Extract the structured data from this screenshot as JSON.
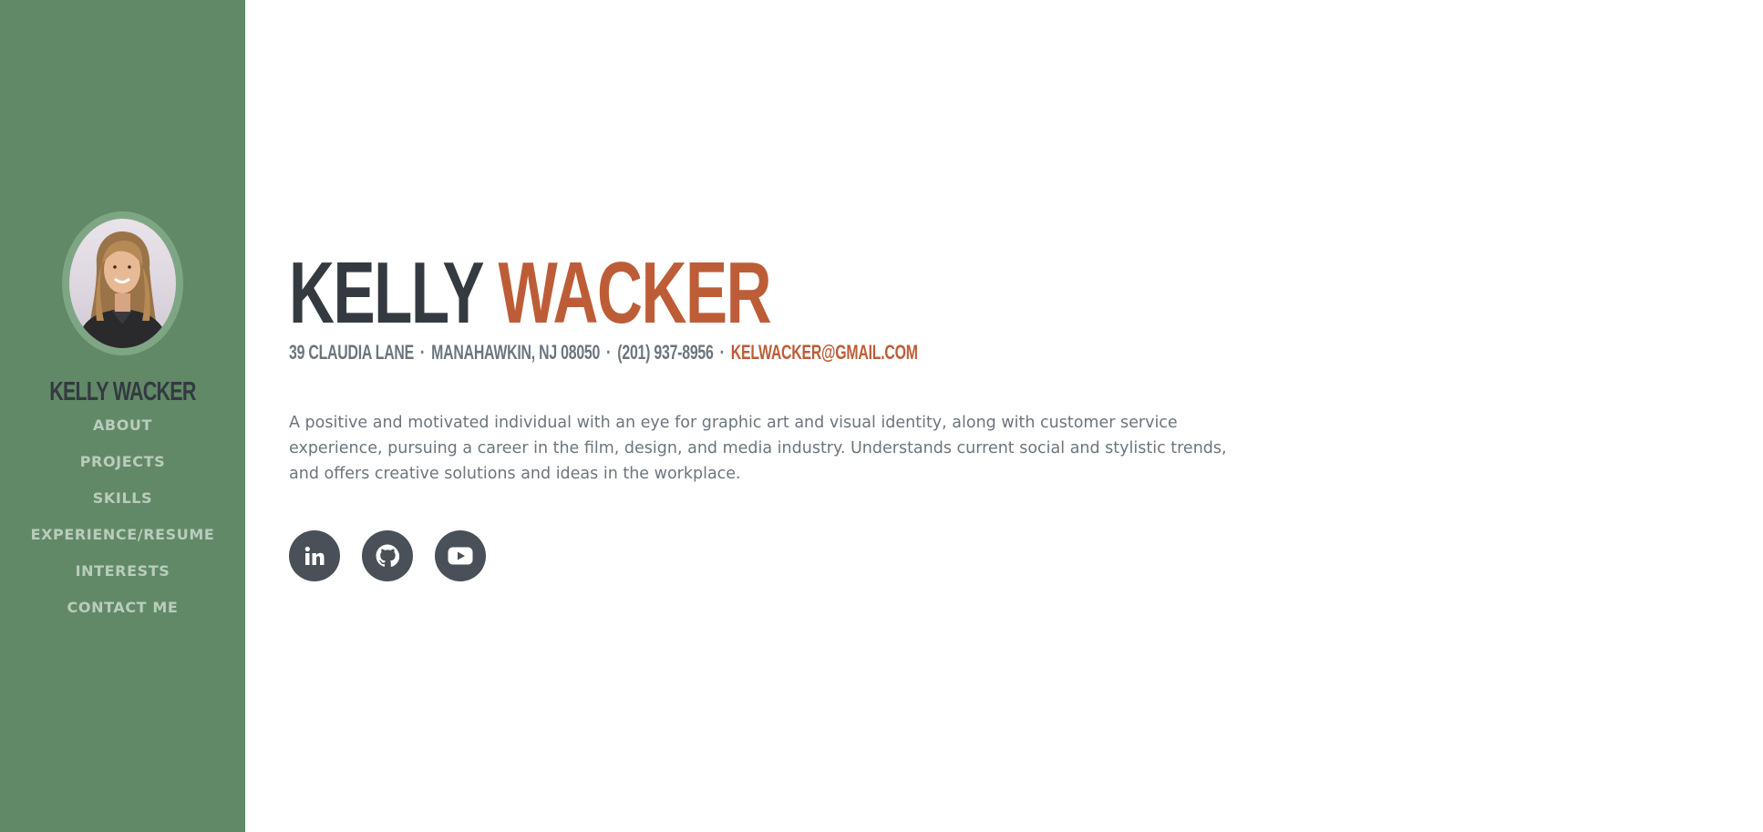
{
  "sidebar": {
    "brand": "Kelly Wacker",
    "avatar_alt": "Profile photo",
    "nav": [
      {
        "label": "ABOUT"
      },
      {
        "label": "PROJECTS"
      },
      {
        "label": "SKILLS"
      },
      {
        "label": "EXPERIENCE/RESUME"
      },
      {
        "label": "INTERESTS"
      },
      {
        "label": "CONTACT ME"
      }
    ]
  },
  "main": {
    "first_name": "Kelly",
    "last_name": "Wacker",
    "address": "39 Claudia Lane",
    "city": "Manahawkin, NJ 08050",
    "phone": "(201) 937-8956",
    "email": "kelwacker@gmail.com",
    "separator": "·",
    "bio": "A positive and motivated individual with an eye for graphic art and visual identity, along with customer service experience, pursuing a career in the film, design, and media industry. Understands current social and stylistic trends, and offers creative solutions and ideas in the workplace."
  },
  "socials": [
    {
      "icon": "linkedin-icon"
    },
    {
      "icon": "github-icon"
    },
    {
      "icon": "youtube-icon"
    }
  ],
  "colors": {
    "sidebar_bg": "#618967",
    "accent": "#bd5d38",
    "dark": "#343a40",
    "muted": "#6c757d",
    "nav_text": "#b9cdbb",
    "social_bg": "#495057"
  }
}
